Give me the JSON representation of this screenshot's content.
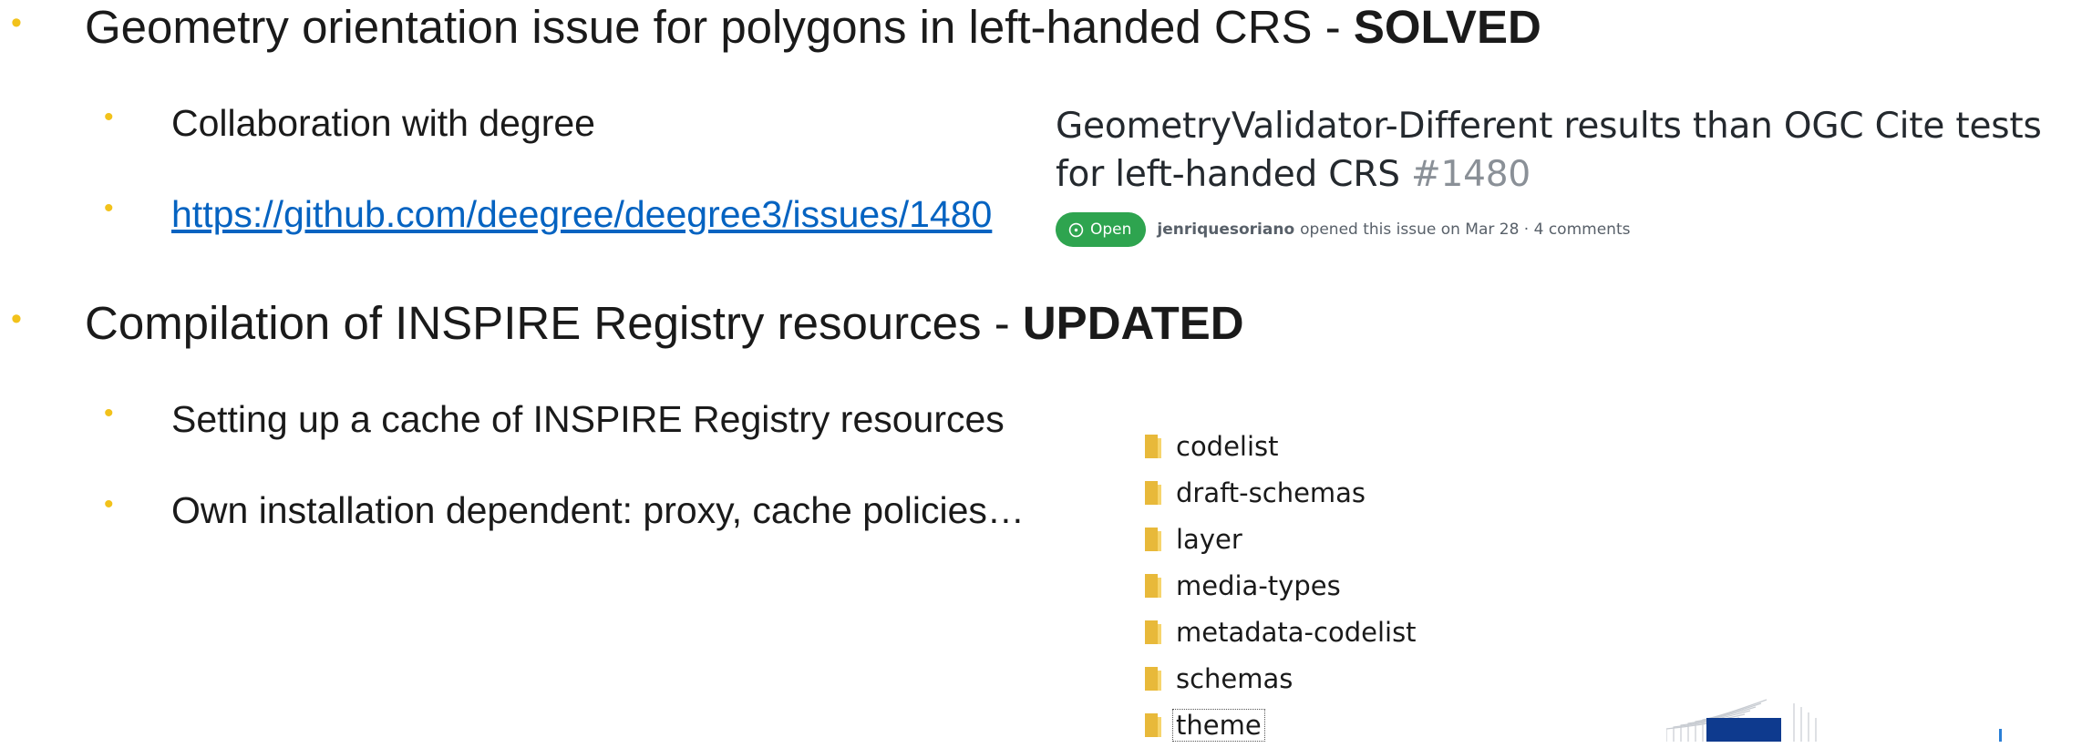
{
  "slide": {
    "sections": [
      {
        "title": "Geometry orientation issue for polygons in left-handed CRS - ",
        "status": "SOLVED",
        "items": [
          {
            "text": "Collaboration with degree"
          },
          {
            "text": "https://github.com/deegree/deegree3/issues/1480"
          }
        ]
      },
      {
        "title": "Compilation of INSPIRE Registry resources - ",
        "status": "UPDATED",
        "items": [
          {
            "text": "Setting up a cache of INSPIRE Registry resources"
          },
          {
            "text": "Own installation dependent: proxy, cache policies…"
          }
        ]
      }
    ],
    "bullet_color": "#f2c21b",
    "link_color": "#0563c1"
  },
  "issue": {
    "title": "GeometryValidator-Different results than OGC Cite tests for left-handed CRS",
    "number": "#1480",
    "state": "Open",
    "state_color": "#2ea44f",
    "state_icon": "issue-opened-icon",
    "author": "jenriquesoriano",
    "meta": "opened this issue on Mar 28 · 4 comments"
  },
  "folders": {
    "icon": "folder-icon",
    "items": [
      "codelist",
      "draft-schemas",
      "layer",
      "media-types",
      "metadata-codelist",
      "schemas",
      "theme"
    ],
    "selected": "theme"
  }
}
